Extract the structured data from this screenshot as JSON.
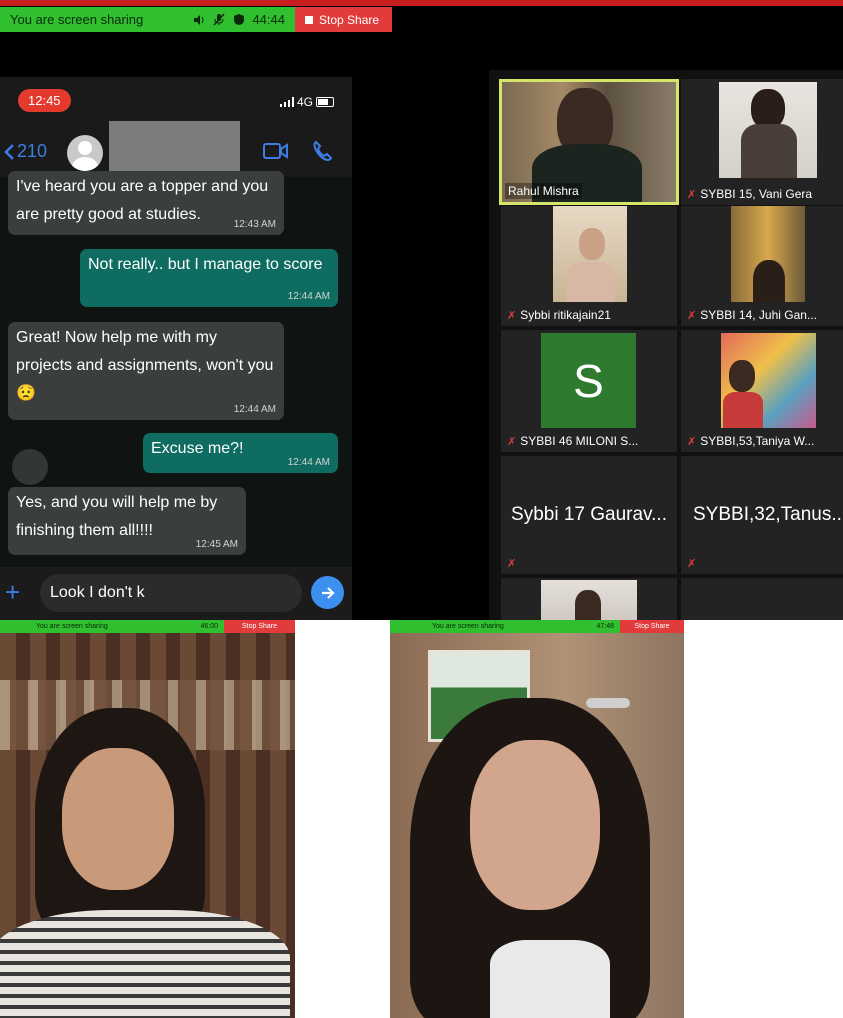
{
  "share_bar": {
    "text": "You are screen sharing",
    "timer": "44:44",
    "stop_label": "Stop Share"
  },
  "phone": {
    "time": "12:45",
    "network": "4G",
    "back_count": "210",
    "messages": [
      {
        "dir": "in",
        "text": "I've heard you are a topper and you are pretty good at studies.",
        "time": "12:43 AM"
      },
      {
        "dir": "out",
        "text": "Not really.. but I manage to score",
        "time": "12:44 AM"
      },
      {
        "dir": "in",
        "text": "Great! Now help me with my projects and assignments, won't you😟",
        "time": "12:44 AM"
      },
      {
        "dir": "out",
        "text": "Excuse me?!",
        "time": "12:44 AM"
      },
      {
        "dir": "in",
        "text": "Yes, and you will help me by finishing them all!!!!",
        "time": "12:45 AM"
      }
    ],
    "compose_value": "Look I don't k"
  },
  "participants": [
    {
      "name": "Rahul Mishra",
      "muted": false,
      "active": true
    },
    {
      "name": "SYBBI 15, Vani Gera",
      "muted": true
    },
    {
      "name": "Sybbi ritikajain21",
      "muted": true
    },
    {
      "name": "SYBBI 14, Juhi Gan...",
      "muted": true
    },
    {
      "name": "SYBBI 46 MILONI S...",
      "muted": true,
      "initial": "S"
    },
    {
      "name": "SYBBI,53,Taniya W...",
      "muted": true
    },
    {
      "name": "Sybbi 17 Gaurav...",
      "muted": true
    },
    {
      "name": "SYBBI,32,Tanus...",
      "muted": true
    }
  ],
  "left_crop": {
    "share_text": "You are screen sharing",
    "timer": "46:00",
    "stop_label": "Stop Share"
  },
  "right_crop": {
    "share_text": "You are screen sharing",
    "timer": "47:48",
    "stop_label": "Stop Share"
  },
  "colors": {
    "share_green": "#2fbf2f",
    "stop_red": "#e23b3b",
    "whatsapp_out": "#0e6d60",
    "whatsapp_in": "#3a3e3d",
    "active_speaker_border": "#d6e56a",
    "link_blue": "#3d7de3"
  }
}
